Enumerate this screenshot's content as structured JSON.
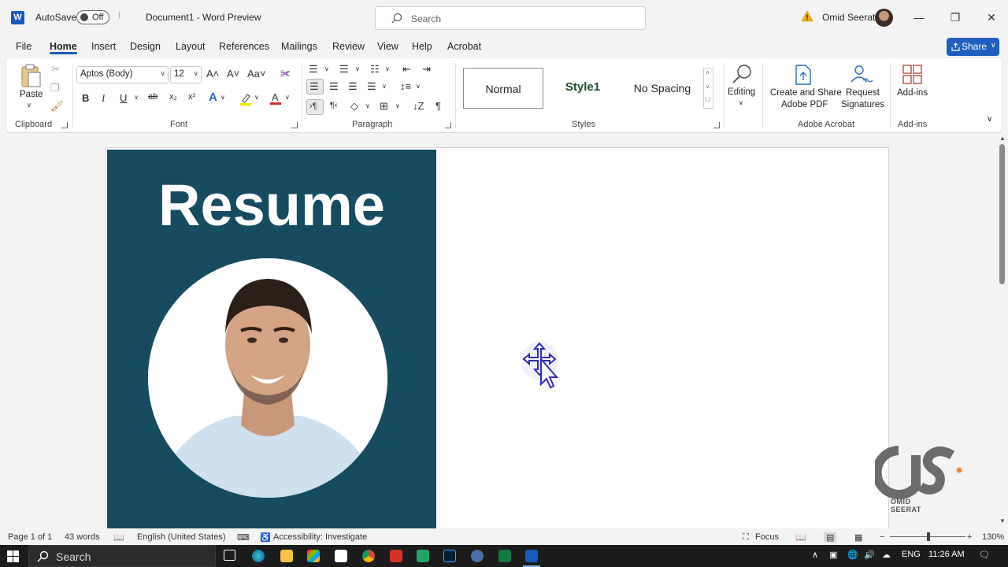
{
  "titlebar": {
    "app_letter": "W",
    "autosave_label": "AutoSave",
    "autosave_state": "Off",
    "doc_title": "Document1  -  Word Preview",
    "search_placeholder": "Search",
    "user_name": "Omid Seerat"
  },
  "tabs": [
    "File",
    "Home",
    "Insert",
    "Design",
    "Layout",
    "References",
    "Mailings",
    "Review",
    "View",
    "Help",
    "Acrobat"
  ],
  "active_tab": "Home",
  "share_label": "Share",
  "ribbon": {
    "clipboard": {
      "paste": "Paste",
      "label": "Clipboard"
    },
    "font": {
      "font_name": "Aptos (Body)",
      "font_size": "12",
      "label": "Font"
    },
    "paragraph": {
      "label": "Paragraph"
    },
    "styles": {
      "normal": "Normal",
      "style1": "Style1",
      "no_spacing": "No Spacing",
      "label": "Styles"
    },
    "editing": {
      "label": "Editing"
    },
    "acrobat": {
      "create_share_1": "Create and Share",
      "create_share_2": "Adobe PDF",
      "request_1": "Request",
      "request_2": "Signatures",
      "label": "Adobe Acrobat"
    },
    "addins": {
      "button": "Add-ins",
      "label": "Add-ins"
    }
  },
  "document": {
    "resume_title": "Resume"
  },
  "watermark": {
    "text": "OMID SEERAT"
  },
  "statusbar": {
    "page": "Page 1 of 1",
    "words": "43 words",
    "language": "English (United States)",
    "accessibility": "Accessibility: Investigate",
    "focus": "Focus",
    "zoom": "130%"
  },
  "taskbar": {
    "search": "Search",
    "lang": "ENG",
    "time": "11:26 AM"
  },
  "colors": {
    "accent": "#185abd",
    "resume_panel": "#154c61",
    "share_button": "#1f5fbf"
  }
}
